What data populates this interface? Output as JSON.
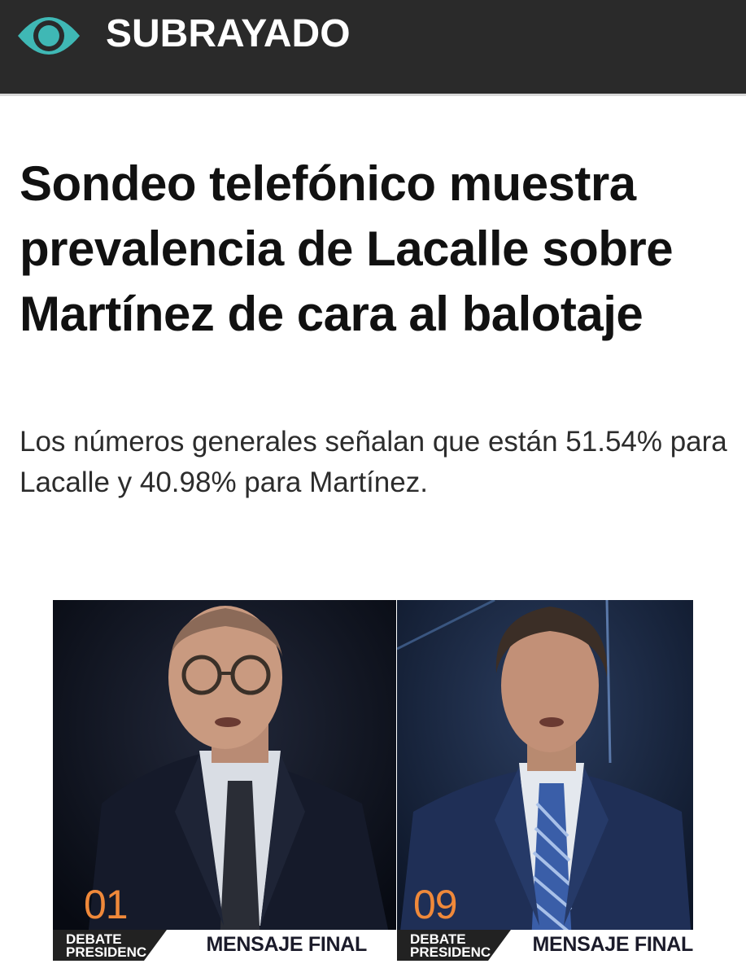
{
  "header": {
    "brand": "SUBRAYADO",
    "logo_icon": "eye-logo-icon",
    "accent": "#3fb8b5"
  },
  "article": {
    "headline": "Sondeo telefónico muestra prevalencia de Lacalle sobre Martínez de cara al balotaje",
    "lede": "Los números generales señalan que están 51.54% para Lacalle y 40.98% para Martínez."
  },
  "photos": [
    {
      "number": "01",
      "tag": "DEBATE PRESIDENCIAL",
      "caption": "MENSAJE FINAL"
    },
    {
      "number": "09",
      "tag": "DEBATE PRESIDENCIAL",
      "caption": "MENSAJE FINAL"
    }
  ]
}
